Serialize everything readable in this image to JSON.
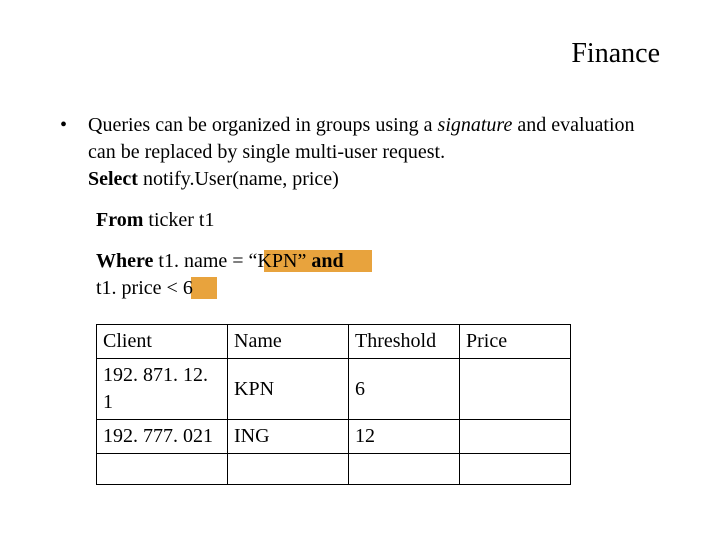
{
  "title": "Finance",
  "bullet": {
    "marker": "•",
    "line1_pre": "Queries can be organized in groups using a ",
    "line1_em": "signature",
    "line1_post": " and evaluation can be replaced by single multi-user request.",
    "select_kw": "Select",
    "select_rest": " notify.User(name, price)"
  },
  "from": {
    "kw": "From",
    "rest": " ticker t1"
  },
  "where": {
    "kw": "Where",
    "mid": " t1. name = “KPN” ",
    "and": "and",
    "line2_pre": "t1. price < ",
    "line2_val": "6"
  },
  "table": {
    "headers": [
      "Client",
      "Name",
      "Threshold",
      "Price"
    ],
    "rows": [
      [
        "192. 871. 12. 1",
        "KPN",
        "6",
        ""
      ],
      [
        "192. 777. 021",
        "ING",
        "12",
        ""
      ],
      [
        "",
        "",
        "",
        ""
      ]
    ]
  }
}
